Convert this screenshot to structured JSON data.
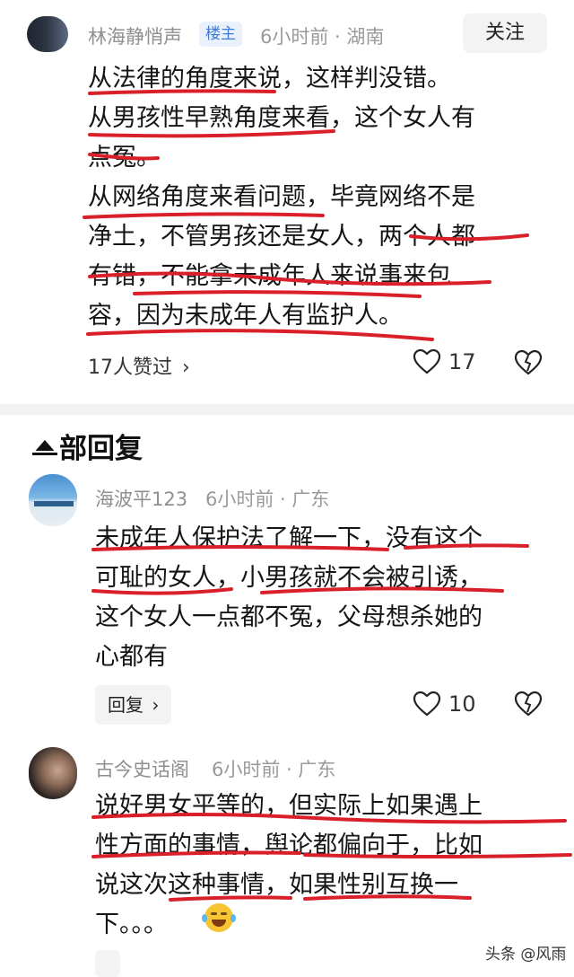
{
  "main_comment": {
    "username": "林海静悄声",
    "badge": "楼主",
    "meta": "6小时前 · 湖南",
    "follow_label": "关注",
    "lines": [
      "从法律的角度来说，这样判没错。",
      "从男孩性早熟角度来看，这个女人有",
      "点冤。",
      "从网络角度来看问题，毕竟网络不是",
      "净土，不管男孩还是女人，两个人都",
      "有错，不能拿未成年人来说事来包",
      "容，因为未成年人有监护人。"
    ],
    "likers_text": "17人赞过",
    "like_count": "17"
  },
  "replies_section": {
    "title": "部回复"
  },
  "replies": [
    {
      "username": "海波平123",
      "meta": "6小时前 · 广东",
      "lines": [
        "未成年人保护法了解一下，没有这个",
        "可耻的女人，小男孩就不会被引诱，",
        "这个女人一点都不冤，父母想杀她的",
        "心都有"
      ],
      "reply_label": "回复",
      "like_count": "10"
    },
    {
      "username": "古今史话阁",
      "meta": "6小时前 · 广东",
      "lines": [
        "说好男女平等的，但实际上如果遇上",
        "性方面的事情，舆论都偏向于，比如",
        "说这次这种事情，如果性别互换一",
        "下。。。"
      ]
    }
  ],
  "watermark": "头条 @风雨",
  "colors": {
    "annotation_red": "#d9202a",
    "badge_blue": "#3d7bd6",
    "meta_gray": "#9a9a9a"
  },
  "icons": {
    "like": "heart-outline-icon",
    "dislike": "broken-heart-icon",
    "chevron": "chevron-right-icon",
    "emoji": "crying-laughing-emoji"
  }
}
